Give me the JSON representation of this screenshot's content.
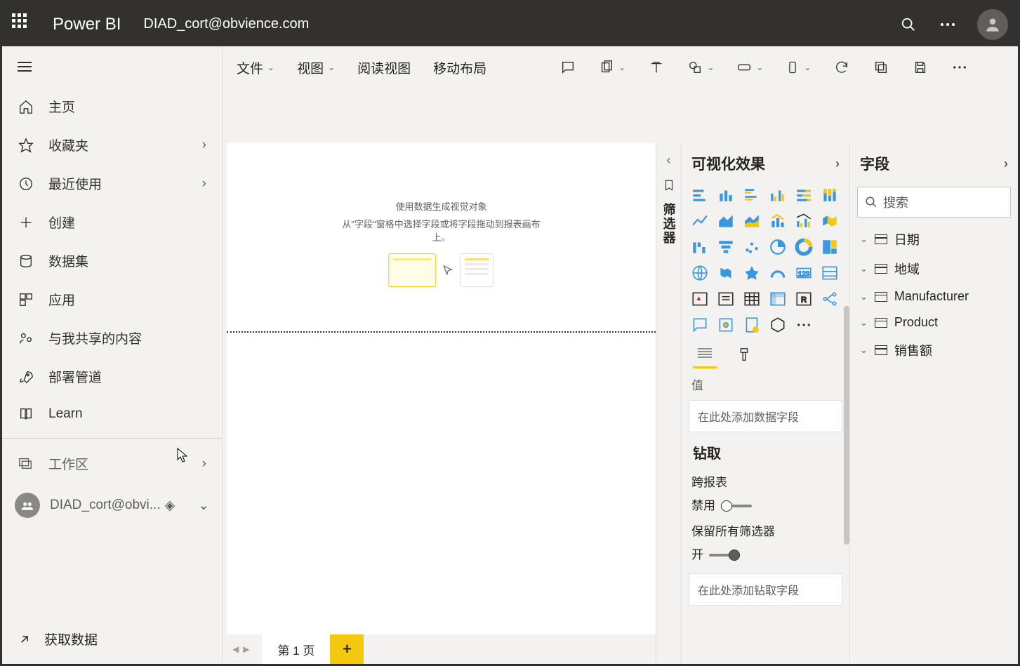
{
  "header": {
    "brand": "Power BI",
    "account": "DIAD_cort@obvience.com"
  },
  "sidebar": {
    "items": [
      {
        "label": "主页"
      },
      {
        "label": "收藏夹",
        "expandable": true
      },
      {
        "label": "最近使用",
        "expandable": true
      },
      {
        "label": "创建"
      },
      {
        "label": "数据集"
      },
      {
        "label": "应用"
      },
      {
        "label": "与我共享的内容"
      },
      {
        "label": "部署管道"
      },
      {
        "label": "Learn"
      }
    ],
    "workspace_label": "工作区",
    "workspace_name": "DIAD_cort@obvi...",
    "get_data": "获取数据"
  },
  "toolbar": {
    "file": "文件",
    "view": "视图",
    "reading": "阅读视图",
    "mobile": "移动布局"
  },
  "canvas": {
    "placeholder_line1": "使用数据生成视觉对象",
    "placeholder_line2": "从\"字段\"窗格中选择字段或将字段拖动到报表画布上。",
    "tab1": "第 1 页"
  },
  "filter_panel": {
    "title": "筛选器"
  },
  "viz_panel": {
    "title": "可视化效果",
    "value_label": "值",
    "value_placeholder": "在此处添加数据字段",
    "drill_title": "钻取",
    "cross_report": "跨报表",
    "cross_report_state": "禁用",
    "keep_filters": "保留所有筛选器",
    "keep_filters_state": "开",
    "drill_placeholder": "在此处添加钻取字段"
  },
  "fields_panel": {
    "title": "字段",
    "search_placeholder": "搜索",
    "tables": [
      "日期",
      "地域",
      "Manufacturer",
      "Product",
      "销售额"
    ]
  }
}
